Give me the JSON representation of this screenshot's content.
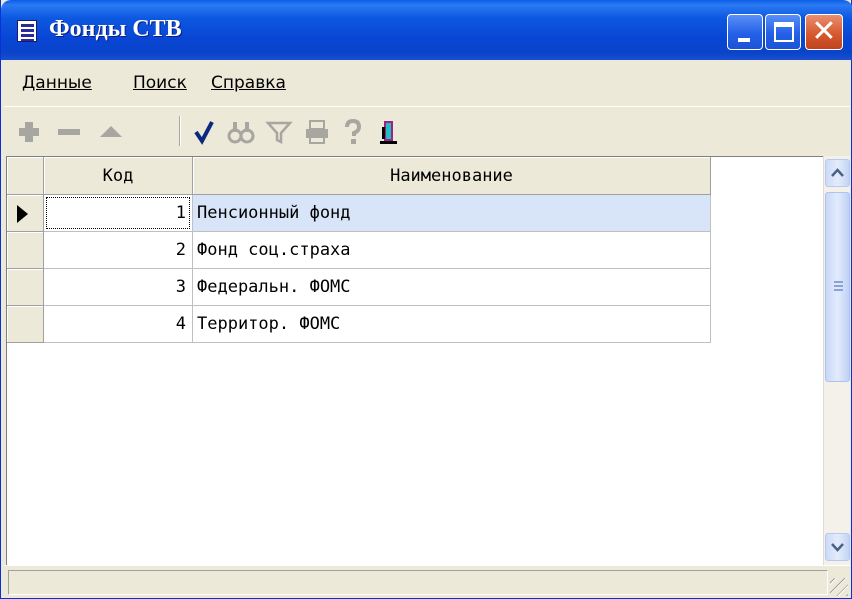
{
  "window": {
    "title": "Фонды СТВ"
  },
  "menu": {
    "items": [
      {
        "label": "Данные"
      },
      {
        "label": "Поиск"
      },
      {
        "label": "Справка"
      }
    ]
  },
  "toolbar": {
    "icons": [
      "plus-icon",
      "minus-icon",
      "up-triangle-icon",
      "checkmark-icon",
      "binoculars-icon",
      "filter-icon",
      "printer-icon",
      "help-icon",
      "exit-door-icon"
    ]
  },
  "grid": {
    "columns": [
      "Код",
      "Наименование"
    ],
    "rows": [
      {
        "code": "1",
        "name": "Пенсионный фонд",
        "selected": true
      },
      {
        "code": "2",
        "name": "Фонд соц.страха",
        "selected": false
      },
      {
        "code": "3",
        "name": "Федеральн. ФОМС",
        "selected": false
      },
      {
        "code": "4",
        "name": "Территор. ФОМС",
        "selected": false
      }
    ]
  },
  "colors": {
    "titlebar": "#0a44c9",
    "selection": "#d8e4f8",
    "face": "#ece9d8"
  }
}
